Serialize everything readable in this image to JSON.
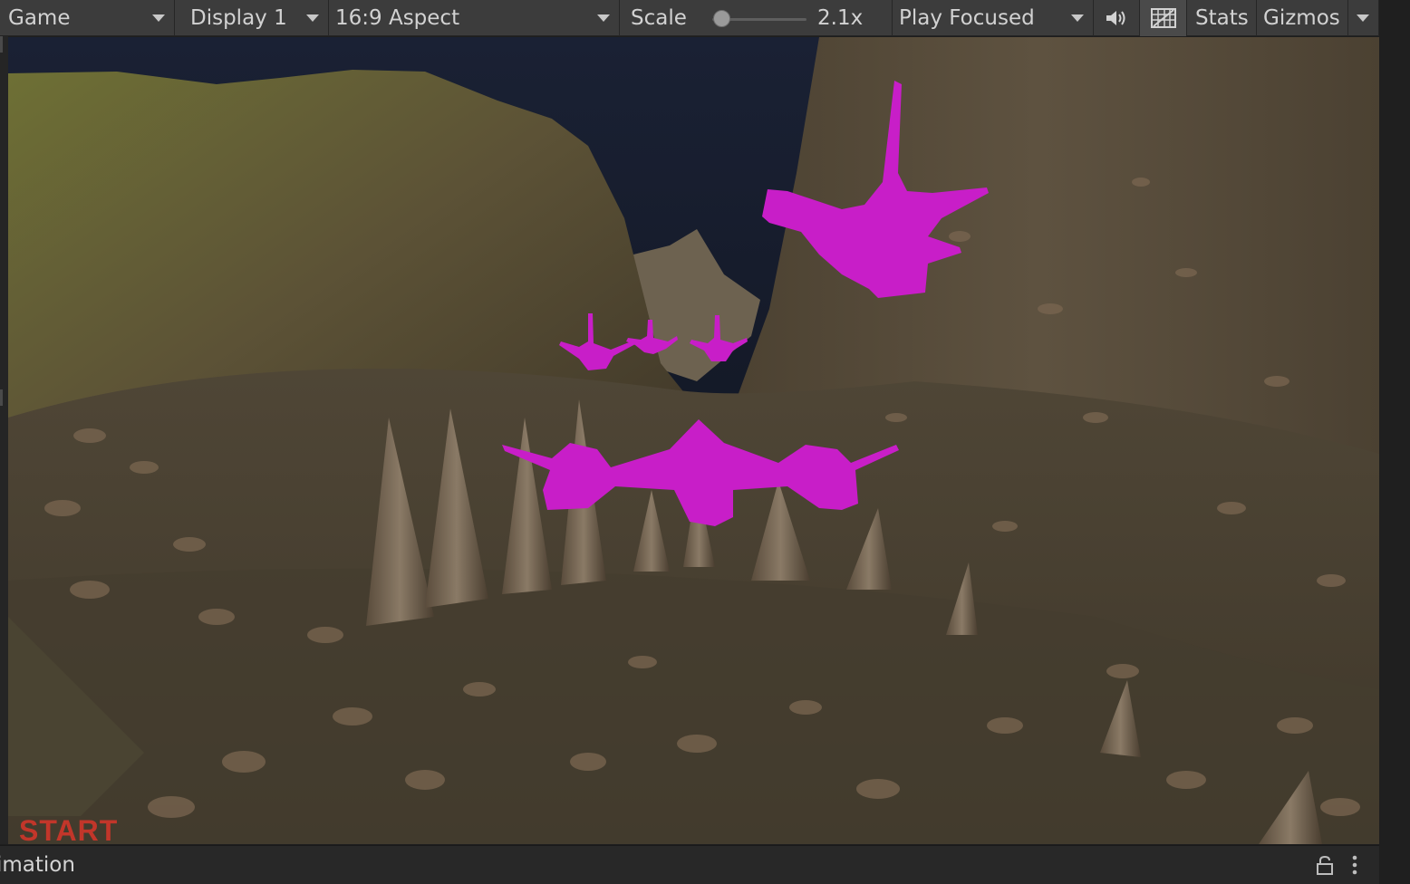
{
  "toolbar": {
    "game_tab": "Game",
    "display": "Display 1",
    "aspect": "16:9 Aspect",
    "scale_label": "Scale",
    "scale_value": "2.1x",
    "scale_slider_fraction": 0.1,
    "play_mode": "Play Focused",
    "audio_icon": "speaker-icon",
    "gizmo_grid_icon": "grid-icon",
    "stats": "Stats",
    "gizmos": "Gizmos"
  },
  "viewport": {
    "hud_start": "START"
  },
  "bottom": {
    "tab_label": "imation",
    "lock_icon": "lock-icon",
    "more_icon": "more-vertical-icon"
  },
  "colors": {
    "toolbar_bg": "#3c3c3c",
    "magenta_missing_material": "#c81ec8",
    "hud_start": "#c2362a"
  }
}
